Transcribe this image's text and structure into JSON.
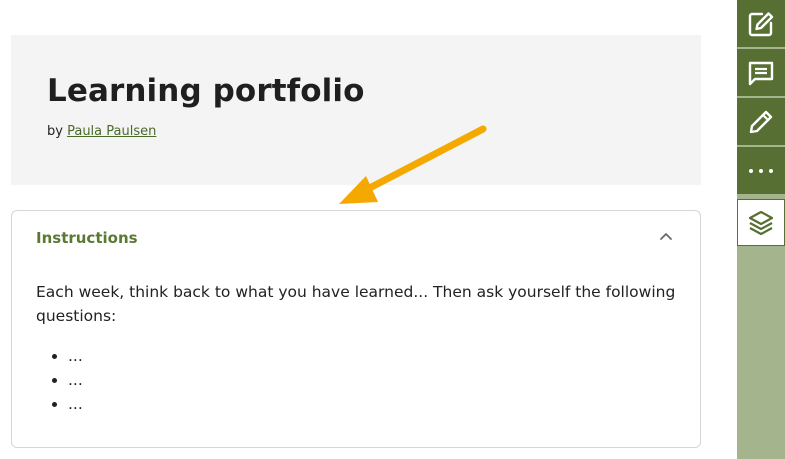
{
  "header": {
    "title": "Learning portfolio",
    "by_prefix": "by",
    "author": "Paula Paulsen"
  },
  "instructions": {
    "title": "Instructions",
    "text": "Each week, think back to what you have learned... Then ask yourself the following questions:",
    "bullets": [
      "...",
      "...",
      "..."
    ],
    "expanded": true
  },
  "sidebar": {
    "buttons": [
      {
        "icon": "edit-note-icon"
      },
      {
        "icon": "comment-icon"
      },
      {
        "icon": "pencil-icon"
      },
      {
        "icon": "more-icon"
      },
      {
        "icon": "layers-icon",
        "active": true
      }
    ]
  },
  "colors": {
    "accent": "#586f33",
    "sidebar_bg": "#a4b48c",
    "panel_title": "#5a7a33",
    "header_bg": "#f4f4f4",
    "annotation_arrow": "#f5a800"
  }
}
